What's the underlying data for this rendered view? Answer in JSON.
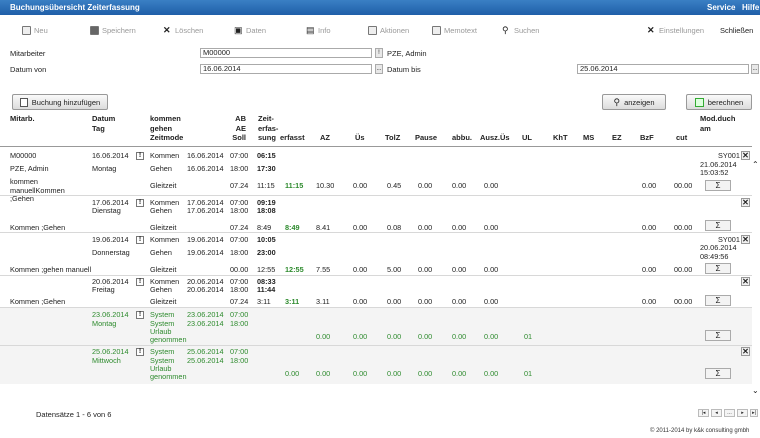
{
  "titlebar": {
    "title": "Buchungsübersicht Zeiterfassung",
    "service": "Service",
    "help": "Hilfe"
  },
  "toolbar": {
    "neu": "Neu",
    "speichern": "Speichern",
    "loeschen": "Löschen",
    "daten": "Daten",
    "info": "Info",
    "aktionen": "Aktionen",
    "memotext": "Memotext",
    "suchen": "Suchen",
    "einstellungen": "Einstellungen",
    "schliessen": "Schließen"
  },
  "form": {
    "mitarbeiter_label": "Mitarbeiter",
    "mitarbeiter_value": "M00000",
    "pze_name": "PZE, Admin",
    "datum_von_label": "Datum von",
    "datum_von_value": "16.06.2014",
    "datum_bis_label": "Datum bis",
    "datum_bis_value": "25.06.2014"
  },
  "buttons": {
    "add": "Buchung hinzufügen",
    "anzeigen": "anzeigen",
    "berechnen": "berechnen"
  },
  "table": {
    "h_mitarb": "Mitarb.",
    "h_datum1": "Datum",
    "h_datum2": "Tag",
    "h_kommen1": "kommen",
    "h_kommen2": "gehen",
    "h_kommen3": "Zeitmode",
    "h_ab1": "AB",
    "h_ab2": "AE",
    "h_ab3": "Soll",
    "h_zeit1": "Zeit-",
    "h_zeit2": "erfas-",
    "h_zeit3": "sung",
    "h_erfasst": "erfasst",
    "h_az": "AZ",
    "h_ues": "Üs",
    "h_tolz": "TolZ",
    "h_pause": "Pause",
    "h_abbu": "abbu.",
    "h_auszues": "Ausz.Üs",
    "h_ul": "UL",
    "h_kht": "KhT",
    "h_ms": "MS",
    "h_ez": "EZ",
    "h_bzf": "BzF",
    "h_cut": "cut",
    "h_mod1": "Mod.duch",
    "h_mod2": "am",
    "sigma": "Σ",
    "r1": {
      "mitarb": "M00000",
      "name": "PZE, Admin",
      "tmode": "kommen manuellKommen ;Gehen",
      "datum": "16.06.2014",
      "tag": "Montag",
      "k1": "Kommen",
      "k1d": "16.06.2014",
      "k1s": "07:00",
      "k1t": "06:15",
      "k2": "Gehen",
      "k2d": "16.06.2014",
      "k2s": "18:00",
      "k2t": "17:30",
      "z": "Gleitzeit",
      "soll": "07.24",
      "erf": "11:15",
      "erfasst": "11:15",
      "az": "10.30",
      "ues": "0.00",
      "tolz": "0.45",
      "pause": "0.00",
      "abbu": "0.00",
      "ausz": "0.00",
      "bzf": "0.00",
      "cut": "00.00",
      "mod": "SY001",
      "modd": "21.06.2014",
      "modt": "15:03:52"
    },
    "r2": {
      "mitarb": "Kommen ;Gehen",
      "datum": "17.06.2014",
      "tag": "Dienstag",
      "k1": "Kommen",
      "k1d": "17.06.2014",
      "k1s": "07:00",
      "k1t": "09:19",
      "k2": "Gehen",
      "k2d": "17.06.2014",
      "k2s": "18:00",
      "k2t": "18:08",
      "z": "Gleitzeit",
      "soll": "07.24",
      "erf": "8:49",
      "erfasst": "8:49",
      "az": "8.41",
      "ues": "0.00",
      "tolz": "0.08",
      "pause": "0.00",
      "abbu": "0.00",
      "ausz": "0.00",
      "bzf": "0.00",
      "cut": "00.00"
    },
    "r3": {
      "mitarb": "Kommen ;gehen manuell",
      "datum": "19.06.2014",
      "tag": "Donnerstag",
      "k1": "Kommen",
      "k1d": "19.06.2014",
      "k1s": "07:00",
      "k1t": "10:05",
      "k2": "Gehen",
      "k2d": "19.06.2014",
      "k2s": "18:00",
      "k2t": "23:00",
      "z": "Gleitzeit",
      "soll": "00.00",
      "erf": "12:55",
      "erfasst": "12:55",
      "az": "7.55",
      "ues": "0.00",
      "tolz": "5.00",
      "pause": "0.00",
      "abbu": "0.00",
      "ausz": "0.00",
      "bzf": "0.00",
      "cut": "00.00",
      "mod": "SY001",
      "modd": "20.06.2014",
      "modt": "08:49:56"
    },
    "r4": {
      "mitarb": "Kommen ;Gehen",
      "datum": "20.06.2014",
      "tag": "Freitag",
      "k1": "Kommen",
      "k1d": "20.06.2014",
      "k1s": "07:00",
      "k1t": "08:33",
      "k2": "Gehen",
      "k2d": "20.06.2014",
      "k2s": "18:00",
      "k2t": "11:44",
      "z": "Gleitzeit",
      "soll": "07.24",
      "erf": "3:11",
      "erfasst": "3:11",
      "az": "3.11",
      "ues": "0.00",
      "tolz": "0.00",
      "pause": "0.00",
      "abbu": "0.00",
      "ausz": "0.00",
      "bzf": "0.00",
      "cut": "00.00"
    },
    "r5": {
      "datum": "23.06.2014",
      "tag": "Montag",
      "k1": "System",
      "k1d": "23.06.2014",
      "k1s": "07:00",
      "k2": "System",
      "k2d": "23.06.2014",
      "k2s": "18:00",
      "z1": "Urlaub",
      "z2": "genommen",
      "az": "0.00",
      "ues": "0.00",
      "tolz": "0.00",
      "pause": "0.00",
      "abbu": "0.00",
      "ausz": "0.00",
      "ul": "01"
    },
    "r6": {
      "datum": "25.06.2014",
      "tag": "Mittwoch",
      "k1": "System",
      "k1d": "25.06.2014",
      "k1s": "07:00",
      "k2": "System",
      "k2d": "25.06.2014",
      "k2s": "18:00",
      "z1": "Urlaub",
      "z2": "genommen",
      "erfasst": "0.00",
      "az": "0.00",
      "ues": "0.00",
      "tolz": "0.00",
      "pause": "0.00",
      "abbu": "0.00",
      "ausz": "0.00",
      "ul": "01"
    }
  },
  "footer": {
    "records": "Datensätze 1 - 6 von 6",
    "copyright": "© 2011-2014 by k&k consulting gmbh"
  }
}
